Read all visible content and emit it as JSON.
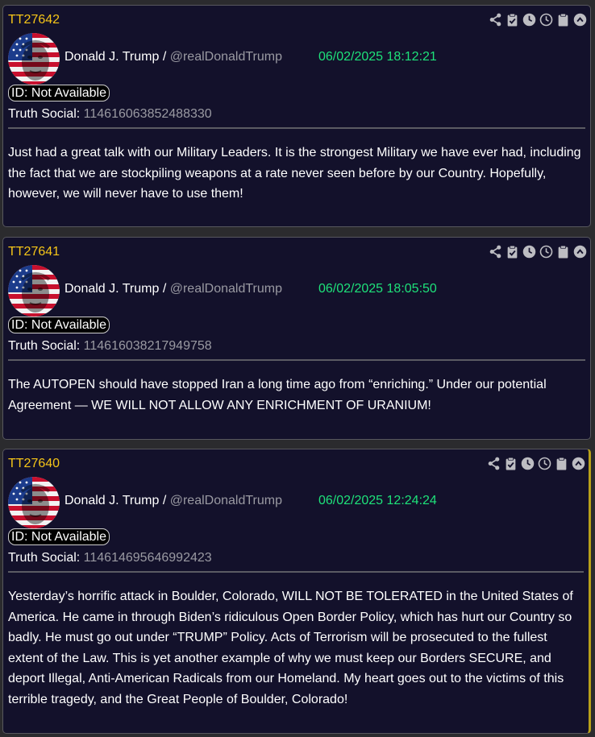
{
  "icons": [
    "share-icon",
    "clipboard-check-icon",
    "clock-filled-icon",
    "clock-outline-icon",
    "clipboard-icon",
    "chevron-up-circle-icon"
  ],
  "colors": {
    "card_bg": "#13112b",
    "post_id": "#f5c518",
    "timestamp": "#1ee27a",
    "muted": "#9a9aa2",
    "highlight_border": "#b8a11a"
  },
  "posts": [
    {
      "post_id": "TT27642",
      "author_name": "Donald J. Trump",
      "author_sep": " / ",
      "author_handle": "@realDonaldTrump",
      "timestamp": "06/02/2025 18:12:21",
      "id_badge": "ID: Not Available",
      "ts_label": "Truth Social: ",
      "ts_value": "114616063852488330",
      "text": "Just had a great talk with our Military Leaders. It is the strongest Military we have ever had, including the fact that we are stockpiling weapons at a rate never seen before by our Country. Hopefully, however, we will never have to use them!"
    },
    {
      "post_id": "TT27641",
      "author_name": "Donald J. Trump",
      "author_sep": " / ",
      "author_handle": "@realDonaldTrump",
      "timestamp": "06/02/2025 18:05:50",
      "id_badge": "ID: Not Available",
      "ts_label": "Truth Social: ",
      "ts_value": "114616038217949758",
      "text": "The AUTOPEN should have stopped Iran a long time ago from “enriching.” Under our potential Agreement — WE WILL NOT ALLOW ANY ENRICHMENT OF URANIUM!"
    },
    {
      "post_id": "TT27640",
      "author_name": "Donald J. Trump",
      "author_sep": " / ",
      "author_handle": "@realDonaldTrump",
      "timestamp": "06/02/2025 12:24:24",
      "id_badge": "ID: Not Available",
      "ts_label": "Truth Social: ",
      "ts_value": "114614695646992423",
      "text": "Yesterday’s horrific attack in Boulder, Colorado, WILL NOT BE TOLERATED in the United States of America. He came in through Biden’s ridiculous Open Border Policy, which has hurt our Country so badly. He must go out under “TRUMP” Policy. Acts of Terrorism will be prosecuted to the fullest extent of the Law. This is yet another example of why we must keep our Borders SECURE, and deport Illegal, Anti-American Radicals from our Homeland. My heart goes out to the victims of this terrible tragedy, and the Great People of Boulder, Colorado!"
    }
  ]
}
